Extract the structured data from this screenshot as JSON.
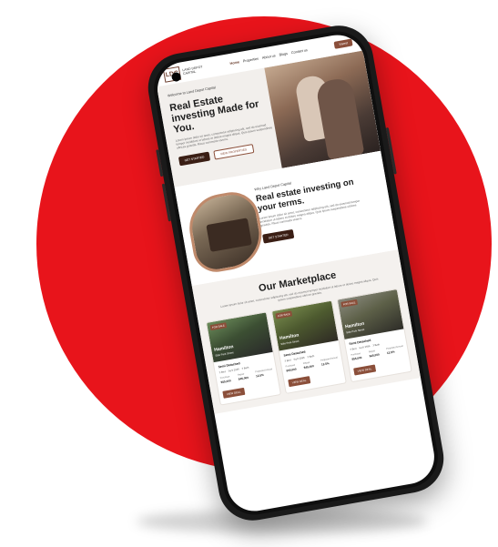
{
  "colors": {
    "background": "#ffffff",
    "accent_red": "#e8141b",
    "brand_brown": "#8b4f3a",
    "dark_button": "#3a1e14"
  },
  "nav": {
    "logo_mark": "LDC",
    "logo_text": [
      "LAND DEPOT",
      "CAPITAL"
    ],
    "links": [
      "Home",
      "Properties",
      "About us",
      "Blogs",
      "Contact us"
    ],
    "cta": "Invest"
  },
  "hero": {
    "eyebrow": "Welcome to Land Depot Capital",
    "title": "Real Estate investing Made for You.",
    "body": "Lorem ipsum dolor sit amet, consectetur adipiscing elit, sed do eiusmod tempor incididunt ut labore et dolore magna aliqua. Quis ipsum suspendisse ultrices gravida. Risus commodo viverra.",
    "primary_button": "GET STARTED",
    "secondary_button": "VIEW PROPERTIES"
  },
  "about": {
    "eyebrow": "Why Land Depot Capital",
    "title": "Real estate investing on your terms.",
    "body": "Lorem ipsum dolor sit amet, consectetur adipiscing elit, sed do eiusmod tempor incididunt ut labore et dolore magna aliqua. Quis ipsum suspendisse ultrices gravida. Risus commodo viverra.",
    "button": "GET STARTED"
  },
  "market": {
    "title": "Our Marketplace",
    "subtitle": "Lorem ipsum dolor sit amet, consectetur adipiscing elit, sed do eiusmod tempor incididunt ut labore et dolore magna aliqua. Quis ipsum suspendisse ultrices gravida.",
    "cards": [
      {
        "badge": "FOR SALE",
        "place": "Hamilton",
        "street": "Side Park Street",
        "type": "Semi Detached",
        "specs": [
          "3 Bed",
          "Sq ft 2596",
          "3 Bath"
        ],
        "metrics": [
          {
            "label": "Purchase",
            "value": "$55,000"
          },
          {
            "label": "Repair",
            "value": "$45,000"
          },
          {
            "label": "Projected Annual",
            "value": "12.5%"
          }
        ],
        "button": "VIEW DEAL"
      },
      {
        "badge": "FOR SALE",
        "place": "Hamilton",
        "street": "Side Park Street",
        "type": "Semi Detached",
        "specs": [
          "3 Bed",
          "Sq ft 2596",
          "3 Bath"
        ],
        "metrics": [
          {
            "label": "Purchase",
            "value": "$55,000"
          },
          {
            "label": "Repair",
            "value": "$45,000"
          },
          {
            "label": "Projected Annual",
            "value": "12.5%"
          }
        ],
        "button": "VIEW DEAL"
      },
      {
        "badge": "FOR SALE",
        "place": "Hamilton",
        "street": "Side Park Street",
        "type": "Semi Detached",
        "specs": [
          "3 Bed",
          "Sq ft 2596",
          "3 Bath"
        ],
        "metrics": [
          {
            "label": "Purchase",
            "value": "$55,000"
          },
          {
            "label": "Repair",
            "value": "$45,000"
          },
          {
            "label": "Projected Annual",
            "value": "12.5%"
          }
        ],
        "button": "VIEW DEAL"
      }
    ]
  }
}
